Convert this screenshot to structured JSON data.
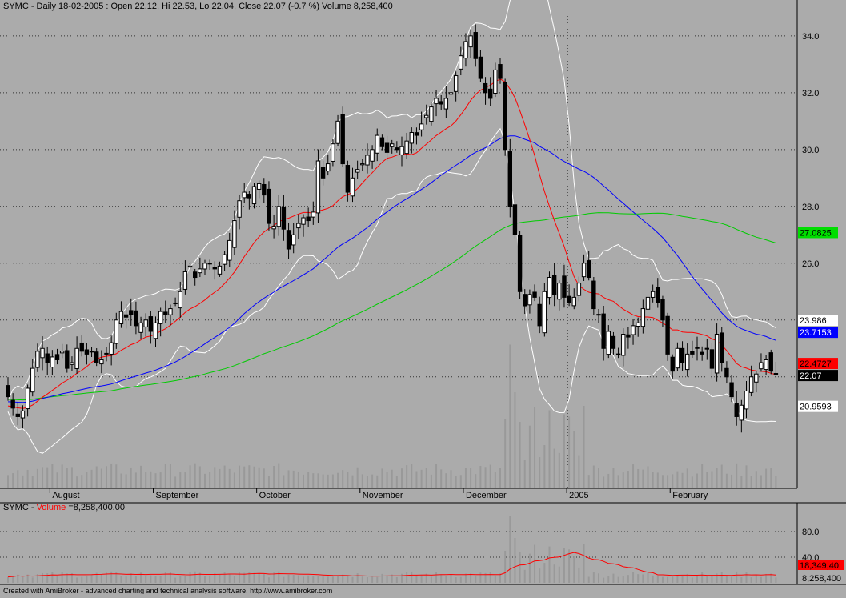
{
  "header": {
    "symbol": "SYMC",
    "info": "SYMC - Daily 18-02-2005 : Open 22.12, Hi 22.53, Lo 22.04, Close 22.07 (-0.7 %) Volume 8,258,400"
  },
  "volume_panel": {
    "prefix": "SYMC - ",
    "label": "Volume",
    "value_text": " =8,258,400.00"
  },
  "footer": {
    "credit": "Created with AmiBroker - advanced charting and technical analysis software. http://www.amibroker.com"
  },
  "colors": {
    "background": "#ababab",
    "ma_short": "#ff0000",
    "ma_mid": "#0000ff",
    "ma_long": "#00cc00",
    "bands": "#ffffff",
    "volume_bar": "#999999",
    "volume_ma": "#ff0000"
  },
  "chart_data": [
    {
      "type": "candlestick",
      "ylim": [
        18.5,
        34.7
      ],
      "y_ticks": [
        "34.0",
        "32.0",
        "30.0",
        "28.0",
        "26.0"
      ],
      "x_labels": [
        "August",
        "September",
        "October",
        "November",
        "December",
        "2005",
        "February"
      ],
      "x_label_index": [
        9,
        30,
        51,
        72,
        93,
        114,
        135
      ],
      "grid": true,
      "badges": [
        {
          "text": "27.0825",
          "value": 27.08,
          "color": "#00dd00"
        },
        {
          "text": "23.986",
          "value": 23.99,
          "color": "#ffffff"
        },
        {
          "text": "23.7153",
          "value": 23.72,
          "color": "#0000ff"
        },
        {
          "text": "22.4727",
          "value": 22.47,
          "color": "#ff0000"
        },
        {
          "text": "22.07",
          "value": 22.07,
          "color": "#000000"
        },
        {
          "text": "20.9593",
          "value": 20.96,
          "color": "#ffffff"
        }
      ],
      "series": [
        {
          "name": "",
          "kind": "ohlc",
          "close": [
            21.3,
            20.9,
            20.6,
            20.8,
            21.6,
            22.3,
            22.9,
            23.0,
            22.5,
            22.7,
            22.6,
            22.9,
            22.3,
            22.5,
            23.0,
            22.9,
            22.8,
            22.9,
            22.5,
            22.6,
            22.8,
            23.2,
            24.0,
            24.3,
            24.1,
            24.2,
            23.8,
            23.9,
            24.0,
            23.6,
            23.9,
            24.3,
            24.2,
            24.4,
            24.6,
            25.0,
            25.7,
            25.9,
            25.5,
            25.8,
            26.0,
            26.0,
            25.8,
            25.9,
            26.3,
            26.8,
            27.5,
            28.2,
            28.5,
            28.3,
            28.7,
            28.8,
            28.4,
            27.4,
            27.3,
            28.0,
            27.2,
            26.5,
            27.0,
            27.4,
            27.6,
            27.5,
            27.8,
            29.6,
            29.0,
            29.5,
            30.2,
            31.0,
            29.5,
            28.5,
            29.0,
            29.3,
            29.5,
            29.8,
            30.0,
            30.5,
            30.1,
            29.9,
            30.2,
            30.0,
            30.1,
            30.3,
            30.6,
            30.5,
            30.9,
            31.2,
            31.5,
            31.8,
            31.6,
            31.8,
            32.0,
            32.6,
            33.3,
            33.8,
            34.0,
            33.2,
            32.5,
            32.0,
            31.8,
            32.8,
            32.5,
            30.0,
            28.0,
            27.0,
            25.0,
            24.5,
            24.9,
            24.8,
            23.8,
            25.0,
            25.5,
            24.9,
            25.3,
            24.8,
            24.6,
            24.8,
            25.3,
            26.0,
            25.5,
            24.4,
            24.2,
            23.0,
            23.6,
            23.0,
            22.8,
            23.5,
            23.4,
            23.8,
            23.9,
            24.4,
            24.8,
            25.0,
            24.6,
            24.0,
            22.8,
            22.2,
            23.0,
            22.5,
            22.8,
            22.8,
            23.0,
            22.8,
            23.0,
            22.3,
            23.5,
            22.5,
            22.0,
            21.3,
            20.6,
            21.0,
            21.5,
            22.0,
            22.1,
            22.5,
            22.6,
            22.2,
            22.07
          ]
        },
        {
          "name": "",
          "kind": "ma",
          "ref": "ma_short"
        },
        {
          "name": "",
          "kind": "ma",
          "ref": "ma_mid"
        },
        {
          "name": "",
          "kind": "ma",
          "ref": "ma_long"
        },
        {
          "name": "",
          "kind": "band",
          "ref": "bands"
        }
      ]
    },
    {
      "type": "bar",
      "y_ticks": [
        "80.0",
        "40.0"
      ],
      "ylim": [
        0,
        110
      ],
      "last_volume_text": "8,258,400",
      "avg_badge": {
        "text": "18,349,40",
        "color": "#ff0000"
      },
      "series": [
        {
          "name": "Volume",
          "kind": "volume"
        },
        {
          "name": "",
          "kind": "volume_ma",
          "ref": "volume_ma"
        }
      ]
    }
  ]
}
